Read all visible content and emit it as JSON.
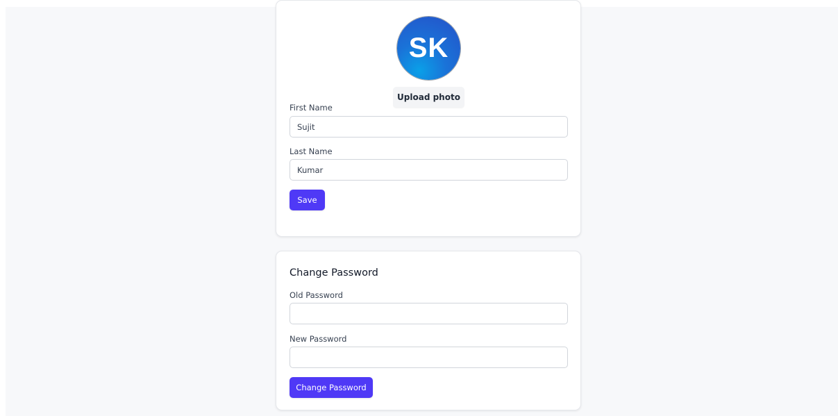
{
  "profile": {
    "avatar_initials": "SK",
    "upload_label": "Upload photo",
    "first_name_label": "First Name",
    "first_name_value": "Sujit",
    "last_name_label": "Last Name",
    "last_name_value": "Kumar",
    "save_label": "Save"
  },
  "password": {
    "title": "Change Password",
    "old_label": "Old Password",
    "old_value": "",
    "new_label": "New Password",
    "new_value": "",
    "submit_label": "Change Password"
  },
  "colors": {
    "primary": "#4f39f6",
    "background": "#f7f8fa",
    "card": "#ffffff"
  }
}
